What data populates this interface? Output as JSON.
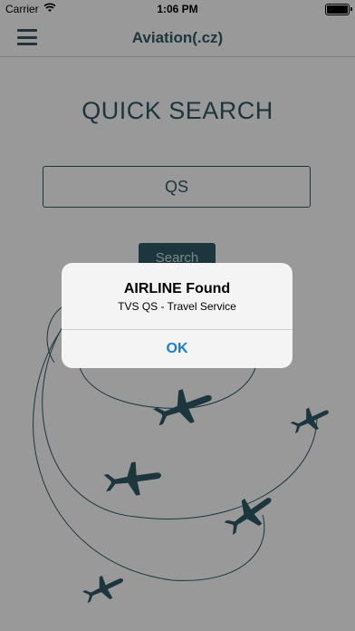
{
  "status_bar": {
    "carrier": "Carrier",
    "time": "1:06 PM"
  },
  "nav": {
    "title": "Aviation(.cz)"
  },
  "main": {
    "heading": "QUICK SEARCH",
    "search_value": "QS",
    "search_button_label": "Search"
  },
  "alert": {
    "title": "AIRLINE Found",
    "message": "TVS QS - Travel Service",
    "ok_label": "OK"
  },
  "colors": {
    "accent": "#2f5a66",
    "link": "#1c7bd9"
  }
}
